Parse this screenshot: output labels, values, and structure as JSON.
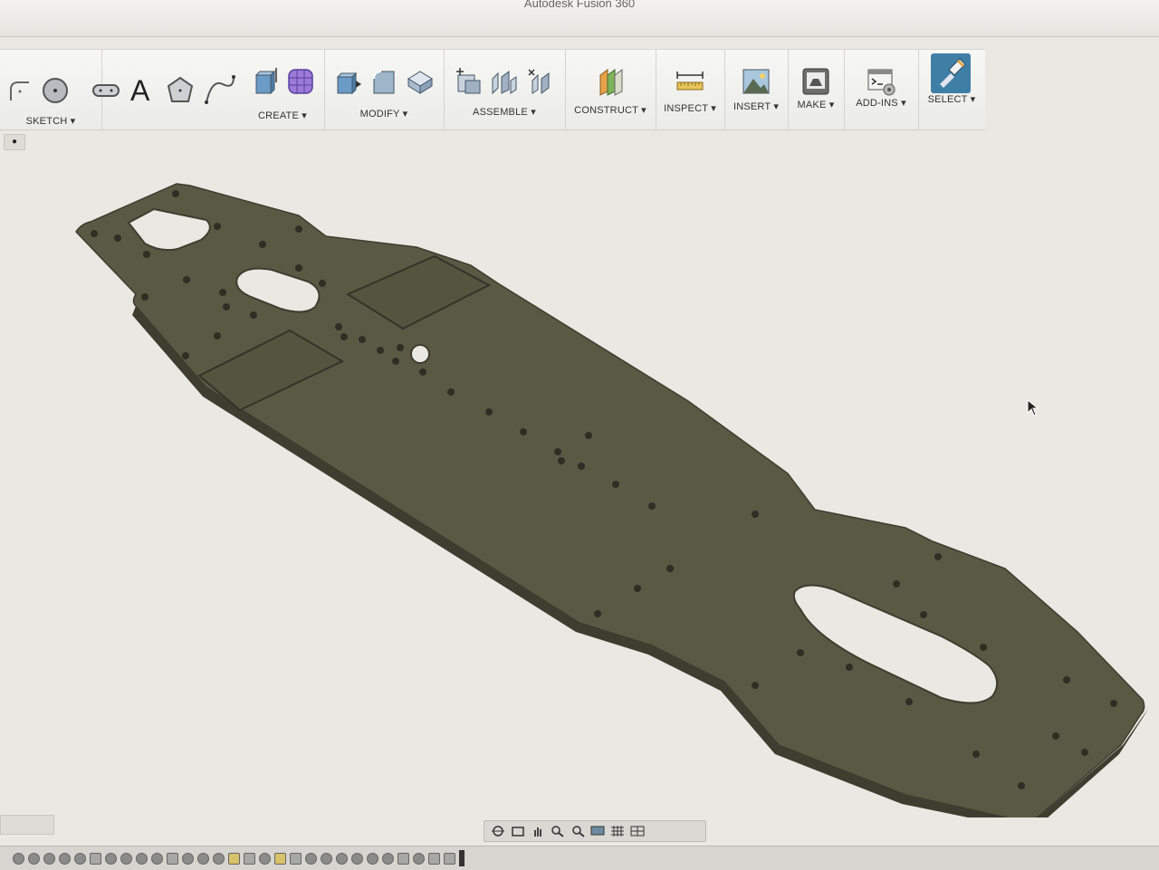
{
  "window": {
    "title": "Autodesk Fusion 360"
  },
  "toolbar": {
    "sketch_label": "SKETCH ▾",
    "create_label": "CREATE ▾",
    "modify_label": "MODIFY ▾",
    "assemble_label": "ASSEMBLE ▾",
    "construct_label": "CONSTRUCT ▾",
    "inspect_label": "INSPECT ▾",
    "insert_label": "INSERT ▾",
    "make_label": "MAKE ▾",
    "addins_label": "ADD-INS ▾",
    "select_label": "SELECT ▾"
  },
  "icons": [
    "fillet-sketch-icon",
    "circle-icon",
    "slot-icon",
    "text-icon",
    "polygon-icon",
    "spline-icon",
    "extrude-icon",
    "form-icon",
    "press-pull-icon",
    "fillet-icon",
    "shell-icon",
    "new-component-icon",
    "joint-icon",
    "as-built-joint-icon",
    "offset-plane-icon",
    "measure-icon",
    "insert-image-icon",
    "3d-print-icon",
    "scripts-icon",
    "select-icon"
  ],
  "viewport": {
    "model": "chassis-plate",
    "plate_color": "#5b5a45",
    "edge_color": "#3e3d2f"
  },
  "colors": {
    "select_bg": "#3f7fa6",
    "toolbar_bg": "#f2f2ef",
    "canvas_bg": "#e9e8e3"
  }
}
